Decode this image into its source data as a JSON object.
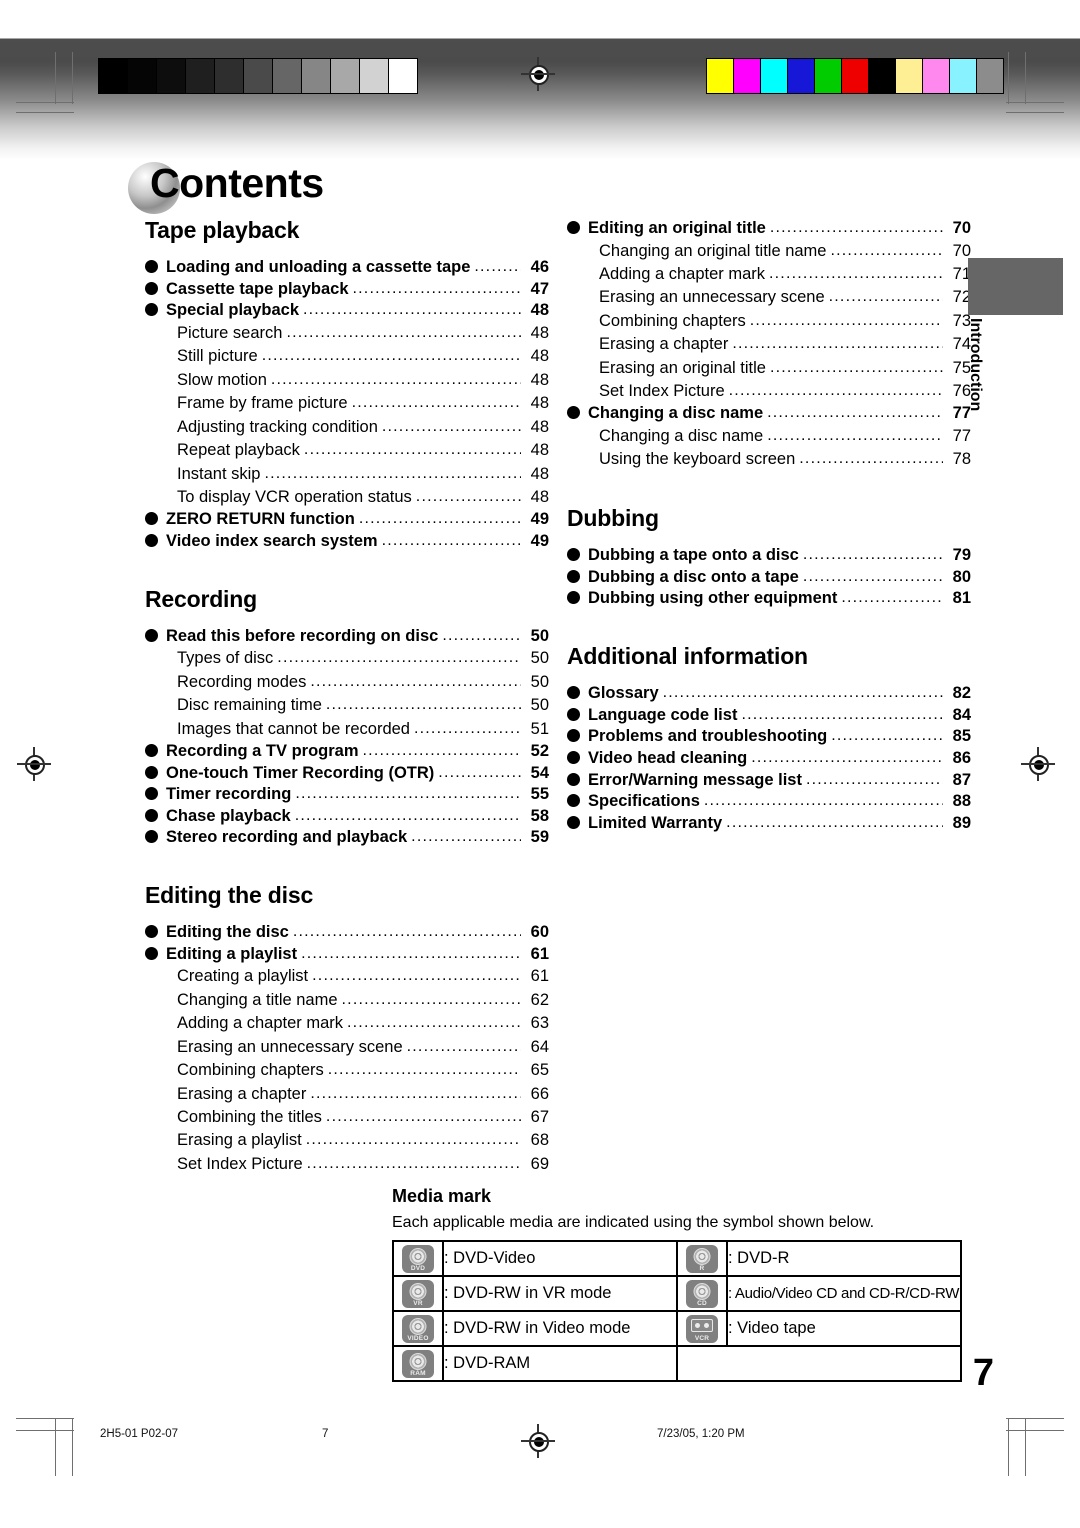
{
  "title": "Contents",
  "side_tab": {
    "label": "Introduction"
  },
  "page_number": "7",
  "footer": {
    "code": "2H5-01 P02-07",
    "page": "7",
    "date": "7/23/05, 1:20 PM"
  },
  "colors": {
    "side_tab_gray": "#666666",
    "media_icon_gray": "#808080",
    "bar_yellow": "#ffff00",
    "bar_magenta": "#ff00ff",
    "bar_cyan": "#00ffff",
    "bar_blue": "#1717d8",
    "bar_green": "#00cc00",
    "bar_red": "#ee0000",
    "bar_black": "#000000",
    "bar_light_yellow": "#ffef94",
    "bar_light_magenta": "#ff88ee",
    "bar_light_cyan": "#88f2ff",
    "bar_gray": "#8c8c8c"
  },
  "gray_wedge": [
    "#000000",
    "#050505",
    "#0d0d0d",
    "#1f1f1f",
    "#2e2e2e",
    "#4a4a4a",
    "#666666",
    "#868686",
    "#a8a8a8",
    "#d2d2d2",
    "#ffffff"
  ],
  "color_bar": [
    "#ffff00",
    "#ff00ff",
    "#00ffff",
    "#1717d8",
    "#00cc00",
    "#ee0000",
    "#000000",
    "#ffef94",
    "#ff88ee",
    "#88f2ff",
    "#8c8c8c"
  ],
  "left_column": [
    {
      "heading": "Tape playback",
      "entries": [
        {
          "level": 1,
          "label": "Loading and unloading a cassette tape",
          "page": "46"
        },
        {
          "level": 1,
          "label": "Cassette tape playback",
          "page": "47"
        },
        {
          "level": 1,
          "label": "Special playback",
          "page": "48"
        },
        {
          "level": 2,
          "label": "Picture search",
          "page": "48"
        },
        {
          "level": 2,
          "label": "Still picture",
          "page": "48"
        },
        {
          "level": 2,
          "label": "Slow motion",
          "page": "48"
        },
        {
          "level": 2,
          "label": "Frame by frame picture",
          "page": "48"
        },
        {
          "level": 2,
          "label": "Adjusting tracking condition",
          "page": "48"
        },
        {
          "level": 2,
          "label": "Repeat playback",
          "page": "48"
        },
        {
          "level": 2,
          "label": "Instant skip",
          "page": "48"
        },
        {
          "level": 2,
          "label": "To display VCR operation status",
          "page": "48"
        },
        {
          "level": 1,
          "label": "ZERO RETURN function",
          "page": "49"
        },
        {
          "level": 1,
          "label": "Video index search system",
          "page": "49"
        }
      ]
    },
    {
      "heading": "Recording",
      "entries": [
        {
          "level": 1,
          "label": "Read this before recording on disc",
          "page": "50"
        },
        {
          "level": 2,
          "label": "Types of disc",
          "page": "50"
        },
        {
          "level": 2,
          "label": "Recording modes",
          "page": "50"
        },
        {
          "level": 2,
          "label": "Disc remaining time",
          "page": "50"
        },
        {
          "level": 2,
          "label": "Images that cannot be recorded",
          "page": "51"
        },
        {
          "level": 1,
          "label": "Recording a TV program",
          "page": "52"
        },
        {
          "level": 1,
          "label": "One-touch Timer Recording (OTR)",
          "page": "54"
        },
        {
          "level": 1,
          "label": "Timer recording",
          "page": "55"
        },
        {
          "level": 1,
          "label": "Chase playback",
          "page": "58"
        },
        {
          "level": 1,
          "label": "Stereo recording and playback",
          "page": "59"
        }
      ]
    },
    {
      "heading": "Editing the disc",
      "entries": [
        {
          "level": 1,
          "label": "Editing the disc",
          "page": "60"
        },
        {
          "level": 1,
          "label": "Editing a playlist",
          "page": "61"
        },
        {
          "level": 2,
          "label": "Creating a playlist",
          "page": "61"
        },
        {
          "level": 2,
          "label": "Changing a title name",
          "page": "62"
        },
        {
          "level": 2,
          "label": "Adding a chapter mark",
          "page": "63"
        },
        {
          "level": 2,
          "label": "Erasing an unnecessary scene",
          "page": "64"
        },
        {
          "level": 2,
          "label": "Combining chapters",
          "page": "65"
        },
        {
          "level": 2,
          "label": "Erasing a chapter",
          "page": "66"
        },
        {
          "level": 2,
          "label": "Combining the titles",
          "page": "67"
        },
        {
          "level": 2,
          "label": "Erasing a playlist",
          "page": "68"
        },
        {
          "level": 2,
          "label": "Set Index Picture",
          "page": "69"
        }
      ]
    }
  ],
  "right_column": [
    {
      "heading": "",
      "entries": [
        {
          "level": 1,
          "label": "Editing an original title",
          "page": "70"
        },
        {
          "level": 2,
          "label": "Changing an original title name",
          "page": "70"
        },
        {
          "level": 2,
          "label": "Adding a chapter mark",
          "page": "71"
        },
        {
          "level": 2,
          "label": "Erasing an unnecessary scene",
          "page": "72"
        },
        {
          "level": 2,
          "label": "Combining chapters",
          "page": "73"
        },
        {
          "level": 2,
          "label": "Erasing a chapter",
          "page": "74"
        },
        {
          "level": 2,
          "label": "Erasing an original title",
          "page": "75"
        },
        {
          "level": 2,
          "label": "Set Index Picture",
          "page": "76"
        },
        {
          "level": 1,
          "label": "Changing a disc name",
          "page": "77"
        },
        {
          "level": 2,
          "label": "Changing a disc name",
          "page": "77"
        },
        {
          "level": 2,
          "label": "Using the keyboard screen",
          "page": "78"
        }
      ]
    },
    {
      "heading": "Dubbing",
      "entries": [
        {
          "level": 1,
          "label": "Dubbing a tape onto a disc",
          "page": "79"
        },
        {
          "level": 1,
          "label": "Dubbing a disc onto a tape",
          "page": "80"
        },
        {
          "level": 1,
          "label": "Dubbing using other equipment",
          "page": "81"
        }
      ]
    },
    {
      "heading": "Additional information",
      "entries": [
        {
          "level": 1,
          "label": "Glossary",
          "page": "82"
        },
        {
          "level": 1,
          "label": "Language code list",
          "page": "84"
        },
        {
          "level": 1,
          "label": "Problems and troubleshooting",
          "page": "85"
        },
        {
          "level": 1,
          "label": "Video head cleaning",
          "page": "86"
        },
        {
          "level": 1,
          "label": "Error/Warning message list",
          "page": "87"
        },
        {
          "level": 1,
          "label": "Specifications",
          "page": "88"
        },
        {
          "level": 1,
          "label": "Limited Warranty",
          "page": "89"
        }
      ]
    }
  ],
  "media_mark": {
    "title": "Media mark",
    "description": "Each applicable media are indicated using the symbol shown below.",
    "rows": [
      {
        "left": {
          "icon": "dvd-video-disc-icon",
          "icon_caption": "DVD",
          "icon_type": "disc",
          "text": ": DVD-Video"
        },
        "right": {
          "icon": "dvd-r-disc-icon",
          "icon_caption": "R",
          "icon_type": "disc",
          "text": ": DVD-R"
        }
      },
      {
        "left": {
          "icon": "dvd-rw-vr-disc-icon",
          "icon_caption": "VR",
          "icon_type": "disc",
          "text": ": DVD-RW in VR mode"
        },
        "right": {
          "icon": "cd-disc-icon",
          "icon_caption": "CD",
          "icon_type": "disc",
          "text": ": Audio/Video CD and CD-R/CD-RW"
        }
      },
      {
        "left": {
          "icon": "dvd-rw-video-disc-icon",
          "icon_caption": "VIDEO",
          "icon_type": "disc",
          "text": ": DVD-RW in Video mode"
        },
        "right": {
          "icon": "vcr-tape-icon",
          "icon_caption": "VCR",
          "icon_type": "tape",
          "text": ": Video tape"
        }
      },
      {
        "left": {
          "icon": "dvd-ram-disc-icon",
          "icon_caption": "RAM",
          "icon_type": "disc",
          "text": ": DVD-RAM"
        },
        "right": null
      }
    ]
  }
}
